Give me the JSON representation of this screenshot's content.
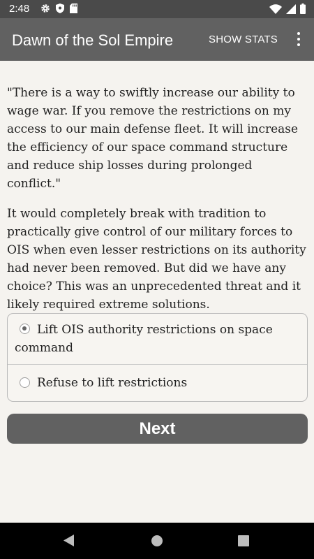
{
  "status_bar": {
    "time": "2:48"
  },
  "app_bar": {
    "title": "Dawn of the Sol Empire",
    "stats_label": "SHOW STATS"
  },
  "content": {
    "paragraph_1": "\"There is a way to swiftly increase our ability to wage war. If you remove the restrictions on my access to our main defense fleet. It will increase the efficiency of our space command structure and reduce ship losses during prolonged conflict.\"",
    "paragraph_2": "It would completely break with tradition to practically give control of our military forces to OIS when even lesser restrictions on its authority had never been removed. But did we have any choice? This was an unprecedented threat and it likely required extreme solutions."
  },
  "choices": [
    {
      "line1": "Lift OIS authority restrictions on space",
      "line2": "command",
      "selected": true
    },
    {
      "label": "Refuse to lift restrictions",
      "selected": false
    }
  ],
  "next_label": "Next",
  "colors": {
    "app_bar": "#616161",
    "background": "#f5f3ef",
    "button": "#616161"
  }
}
